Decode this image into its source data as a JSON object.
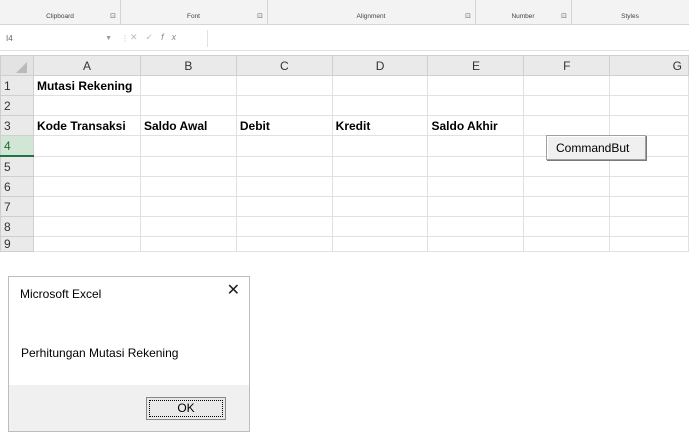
{
  "ribbon": {
    "groups": [
      {
        "label": "Clipboard",
        "launcher": "⊡"
      },
      {
        "label": "Font",
        "launcher": "⊡"
      },
      {
        "label": "Alignment",
        "launcher": "⊡"
      },
      {
        "label": "Number",
        "launcher": "⊡"
      },
      {
        "label": "Styles",
        "launcher": ""
      }
    ]
  },
  "formula_bar": {
    "name_box": "I4",
    "fx": "fx",
    "value": ""
  },
  "grid": {
    "columns": [
      "A",
      "B",
      "C",
      "D",
      "E",
      "F",
      "G"
    ],
    "rows": [
      "1",
      "2",
      "3",
      "4",
      "5",
      "6",
      "7",
      "8",
      "9"
    ],
    "selected_row": "4",
    "cells": {
      "A1": "Mutasi Rekening",
      "A3": "Kode Transaksi",
      "B3": "Saldo Awal",
      "C3": "Debit",
      "D3": "Kredit",
      "E3": "Saldo Akhir"
    }
  },
  "command_button": {
    "label": "CommandBut"
  },
  "message_box": {
    "title": "Microsoft Excel",
    "close": "✕",
    "text": "Perhitungan Mutasi Rekening",
    "ok_label": "OK"
  }
}
